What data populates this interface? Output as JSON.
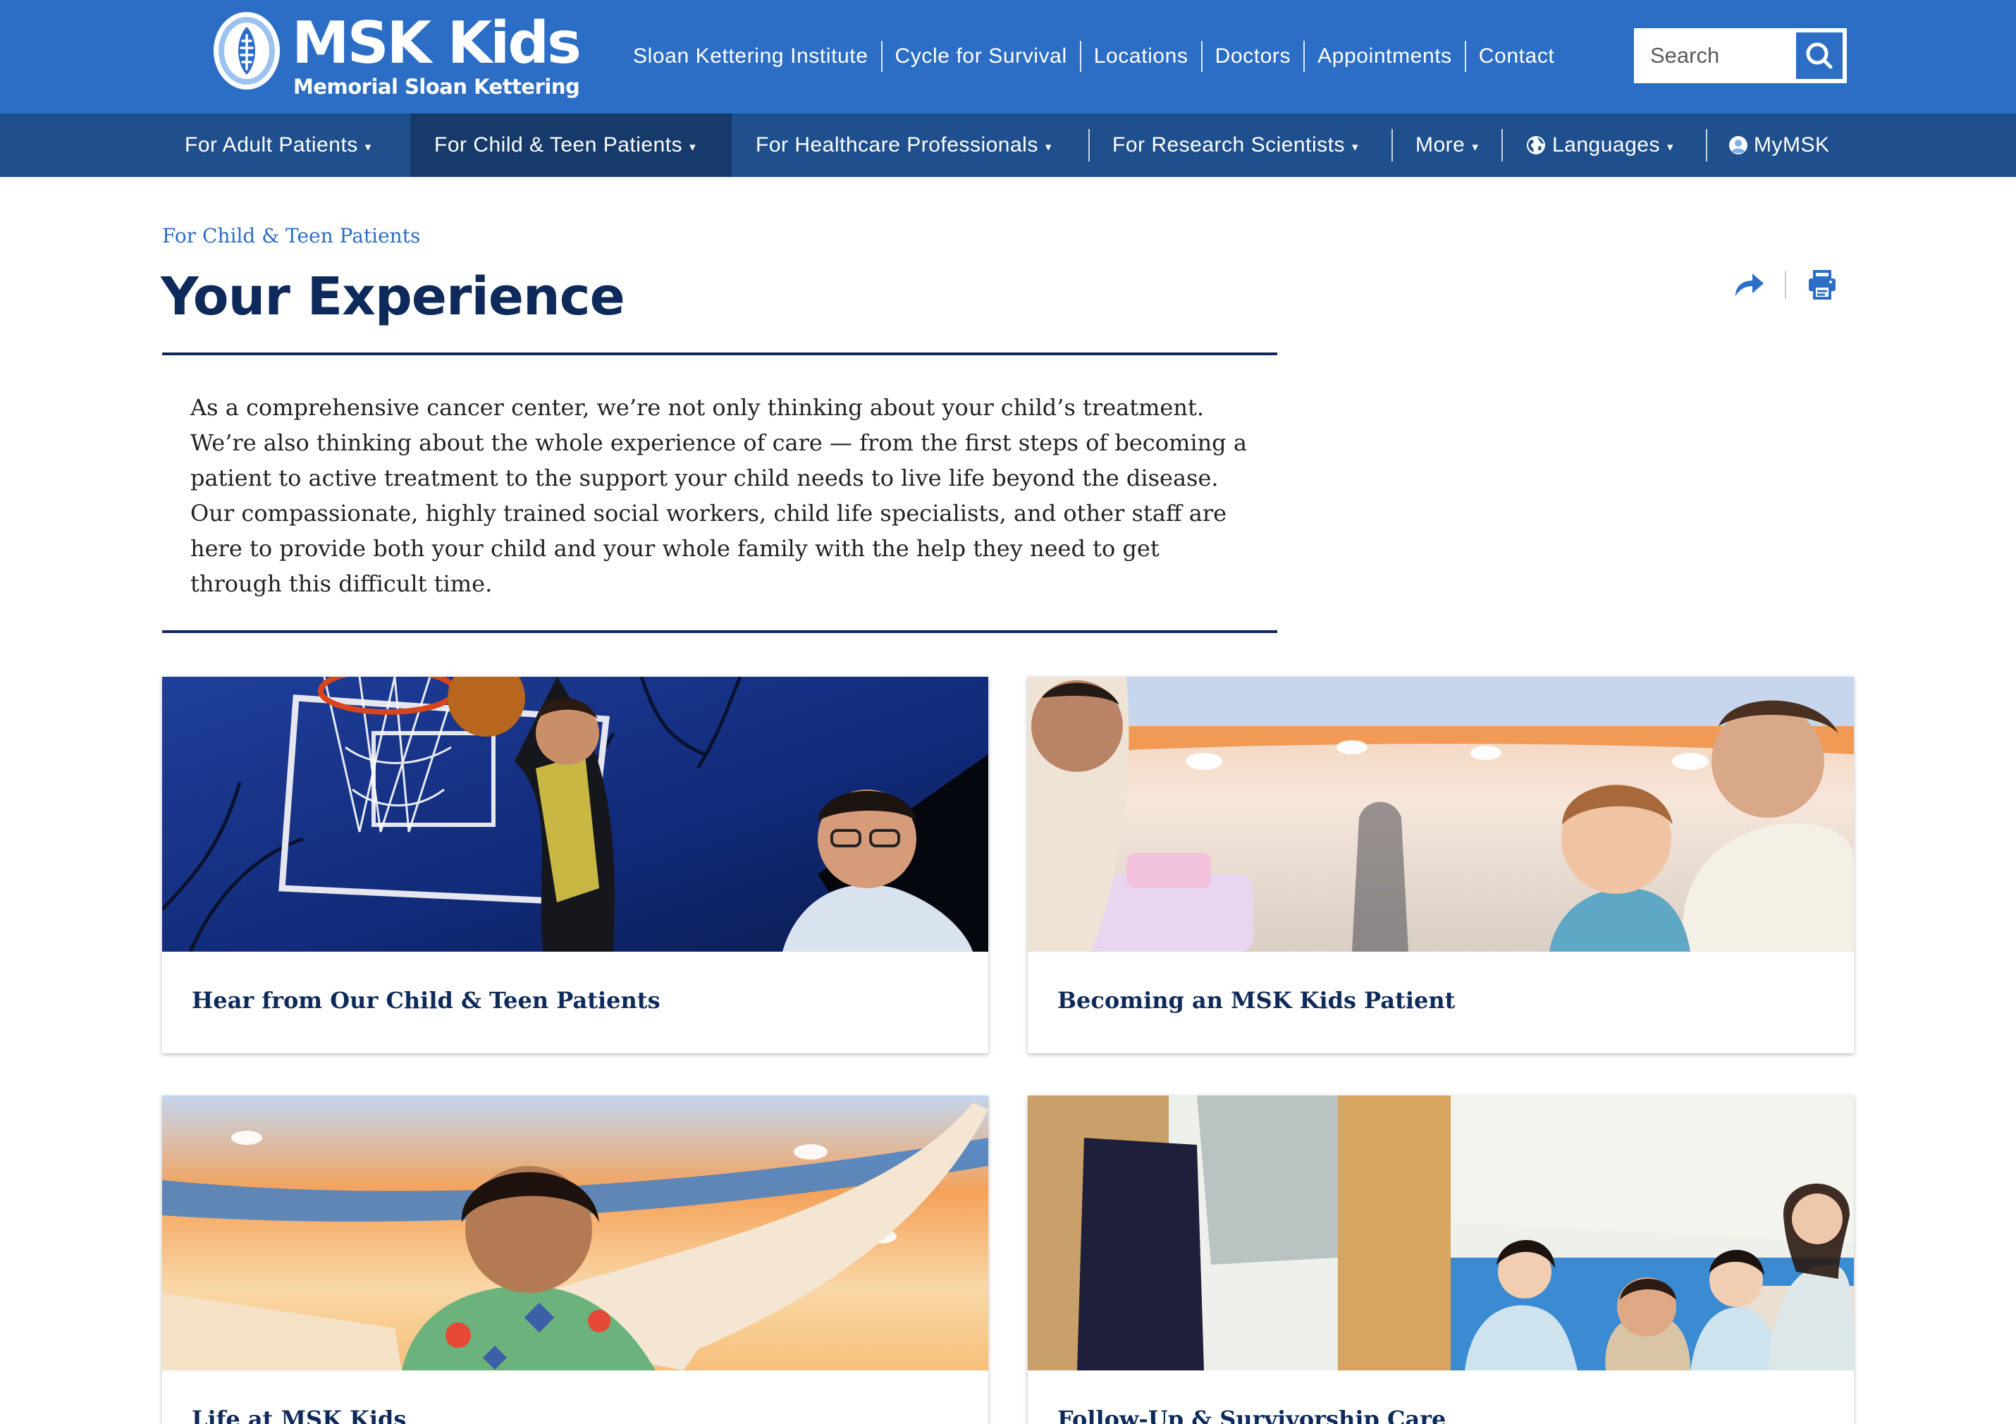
{
  "header": {
    "logo_title": "MSK Kids",
    "logo_subtitle": "Memorial Sloan Kettering",
    "utility_links": [
      "Sloan Kettering Institute",
      "Cycle for Survival",
      "Locations",
      "Doctors",
      "Appointments",
      "Contact"
    ],
    "search_placeholder": "Search",
    "brand_color": "#2c6ec5"
  },
  "nav": {
    "items": [
      {
        "label": "For Adult Patients",
        "caret": "▾"
      },
      {
        "label": "For Child & Teen Patients",
        "caret": "▾"
      },
      {
        "label": "For Healthcare Professionals",
        "caret": "▾"
      },
      {
        "label": "For Research Scientists",
        "caret": "▾"
      },
      {
        "label": "More",
        "caret": "▾"
      },
      {
        "label": "Languages",
        "caret": "▾"
      },
      {
        "label": "MyMSK"
      }
    ],
    "active_label": "For Child & Teen Patients",
    "nav_color": "#1f4f8d",
    "active_color": "#163a6a"
  },
  "page": {
    "breadcrumb": "For Child & Teen Patients",
    "title": "Your Experience",
    "intro": "As a comprehensive cancer center, we’re not only thinking about your child’s treatment. We’re also thinking about the whole experience of care — from the first steps of becoming a patient to active treatment to the support your child needs to live life beyond the disease. Our compassionate, highly trained social workers, child life specialists, and other staff are here to provide both your child and your whole family with the help they need to get through this difficult time.",
    "title_color": "#0e2a5a"
  },
  "tools": {
    "share_icon": "share-arrow-icon",
    "print_icon": "printer-icon"
  },
  "cards": [
    {
      "title": "Hear from Our Child & Teen Patients",
      "photo": "boy dunking basketball with doctor"
    },
    {
      "title": "Becoming an MSK Kids Patient",
      "photo": "young boy with father in playroom"
    },
    {
      "title": "Life at MSK Kids",
      "photo": "girl with outstretched arms"
    },
    {
      "title": "Follow-Up & Survivorship Care",
      "photo": "family portrait in hospital lobby"
    }
  ]
}
